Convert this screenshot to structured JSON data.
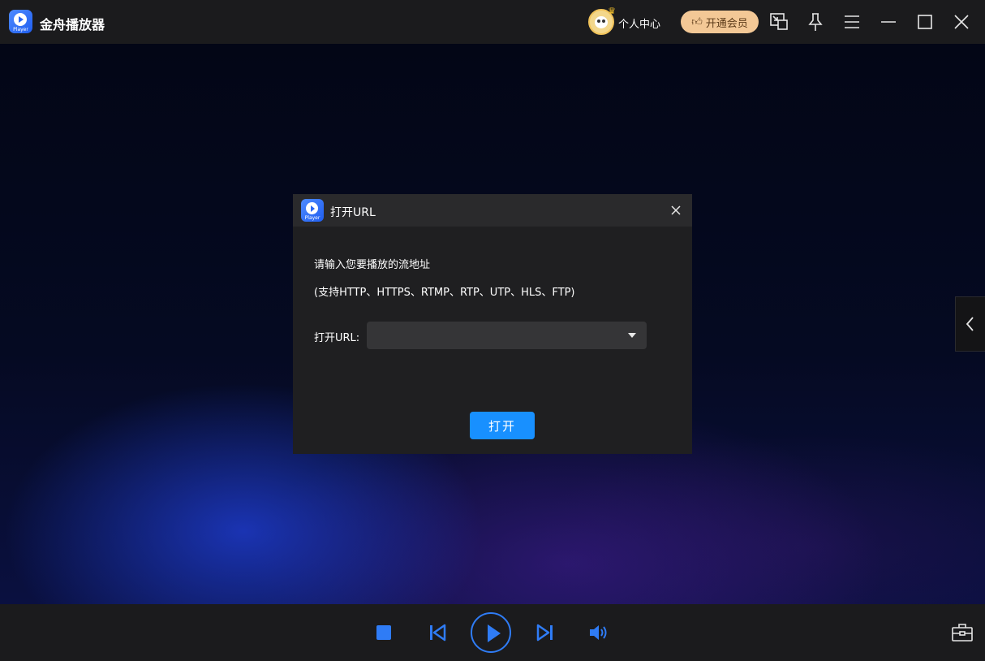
{
  "app": {
    "title": "金舟播放器",
    "logo_caption": "Player"
  },
  "header": {
    "personal_center": "个人中心",
    "vip_button": "开通会员",
    "icons": [
      "avatar-icon",
      "pip-icon",
      "pin-icon",
      "menu-icon",
      "minimize-icon",
      "maximize-icon",
      "close-icon"
    ]
  },
  "dialog": {
    "title": "打开URL",
    "logo_caption": "Player",
    "prompt": "请输入您要播放的流地址",
    "supported": "(支持HTTP、HTTPS、RTMP、RTP、UTP、HLS、FTP)",
    "url_label": "打开URL:",
    "url_value": "",
    "open_button": "打开"
  },
  "controls": {
    "icons": [
      "stop-icon",
      "previous-icon",
      "play-icon",
      "next-icon",
      "volume-icon",
      "toolbox-icon"
    ]
  },
  "colors": {
    "accent": "#2f7cf6",
    "primary_button": "#1890ff",
    "vip": "#f3c896",
    "bar": "#1b1b1d",
    "dialog": "#1f1f21"
  }
}
